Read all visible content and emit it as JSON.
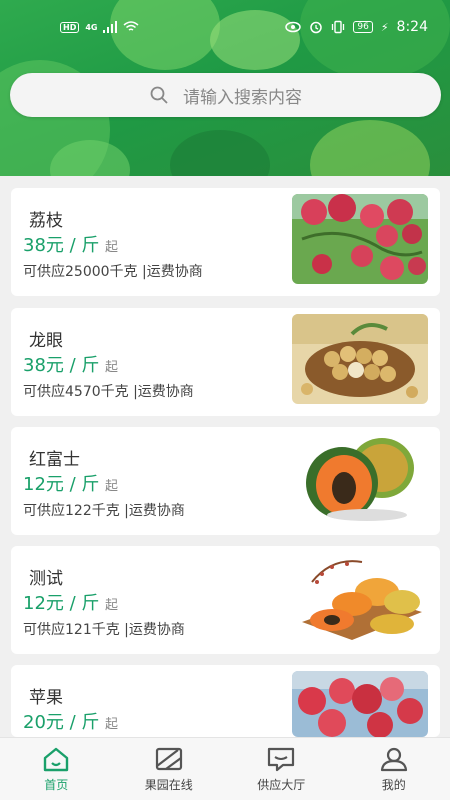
{
  "status_bar": {
    "hd_badge": "HD",
    "network": "4G",
    "battery": "96",
    "time": "8:24"
  },
  "search": {
    "placeholder": "请输入搜索内容"
  },
  "products": [
    {
      "name": "荔枝",
      "price": "38元 / 斤",
      "from": "起",
      "supply": "可供应25000千克 |运费协商",
      "image": "lychee"
    },
    {
      "name": "龙眼",
      "price": "38元 / 斤",
      "from": "起",
      "supply": "可供应4570千克 |运费协商",
      "image": "longan"
    },
    {
      "name": "红富士",
      "price": "12元 / 斤",
      "from": "起",
      "supply": "可供应122千克 |运费协商",
      "image": "papaya"
    },
    {
      "name": "测试",
      "price": "12元 / 斤",
      "from": "起",
      "supply": "可供应121千克 |运费协商",
      "image": "papaya-basket"
    },
    {
      "name": "苹果",
      "price": "20元 / 斤",
      "from": "起",
      "supply": "",
      "image": "apple"
    }
  ],
  "tabbar": {
    "items": [
      {
        "label": "首页",
        "icon": "home-icon",
        "active": true
      },
      {
        "label": "果园在线",
        "icon": "orchard-icon",
        "active": false
      },
      {
        "label": "供应大厅",
        "icon": "message-icon",
        "active": false
      },
      {
        "label": "我的",
        "icon": "user-icon",
        "active": false
      }
    ]
  },
  "colors": {
    "accent": "#1aa06a",
    "hero_green": "#27a14b"
  }
}
